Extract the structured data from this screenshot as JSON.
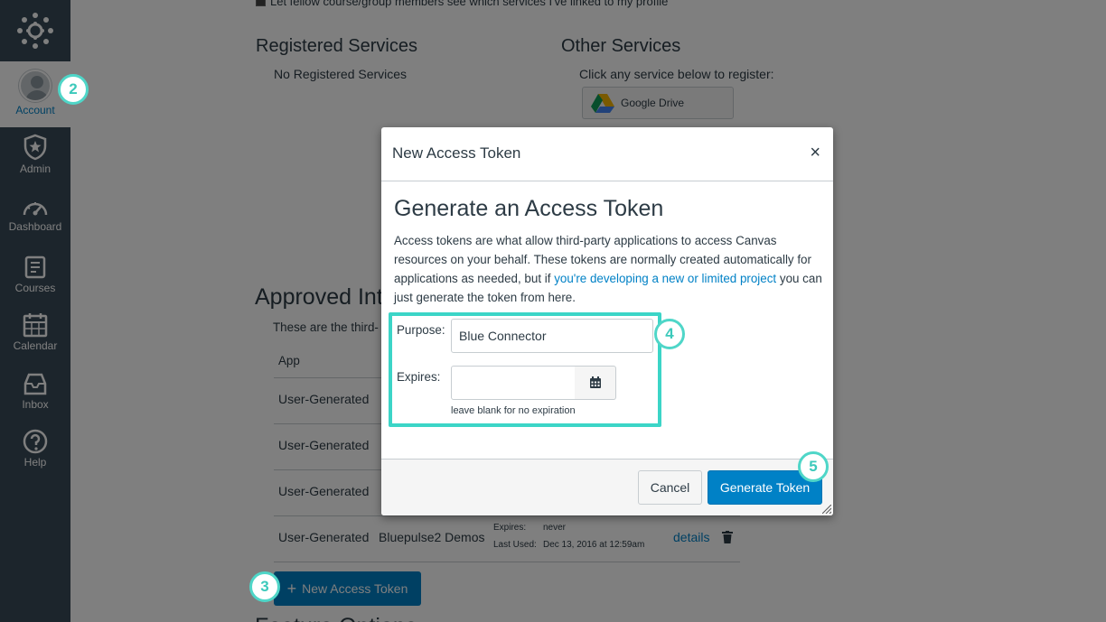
{
  "sidebar": {
    "items": [
      {
        "label": "Account"
      },
      {
        "label": "Admin"
      },
      {
        "label": "Dashboard"
      },
      {
        "label": "Courses"
      },
      {
        "label": "Calendar"
      },
      {
        "label": "Inbox"
      },
      {
        "label": "Help"
      }
    ]
  },
  "background": {
    "checkbox_text": "Let fellow course/group members see which services I've linked to my profile",
    "registered_services": {
      "title": "Registered Services",
      "empty": "No Registered Services"
    },
    "other_services": {
      "title": "Other Services",
      "hint": "Click any service below to register:",
      "google_drive": "Google Drive"
    },
    "approved": {
      "title": "Approved Int",
      "desc": "These are the third-",
      "col_app": "App",
      "rows": [
        {
          "app": "User-Generated"
        },
        {
          "app": "User-Generated"
        },
        {
          "app": "User-Generated"
        },
        {
          "app": "User-Generated",
          "purpose": "Bluepulse2 Demos",
          "expires_label": "Expires:",
          "expires_value": "never",
          "last_used_label": "Last Used:",
          "last_used_value": "Dec 13, 2016 at 12:59am",
          "details": "details"
        }
      ]
    },
    "new_token_button": "New Access Token",
    "feature_title": "Feature Options"
  },
  "dialog": {
    "title": "New Access Token",
    "close": "×",
    "heading": "Generate an Access Token",
    "desc_before": "Access tokens are what allow third-party applications to access Canvas resources on your behalf. These tokens are normally created automatically for applications as needed, but if ",
    "desc_link": "you're developing a new or limited project",
    "desc_after": " you can just generate the token from here.",
    "purpose_label": "Purpose:",
    "purpose_value": "Blue Connector",
    "expires_label": "Expires:",
    "expires_value": "",
    "expires_hint": "leave blank for no expiration",
    "cancel": "Cancel",
    "generate": "Generate Token"
  },
  "callouts": [
    "2",
    "3",
    "4",
    "5"
  ],
  "colors": {
    "sidebar": "#394b58",
    "primary": "#0081c6",
    "callout": "#3cd5c7"
  }
}
